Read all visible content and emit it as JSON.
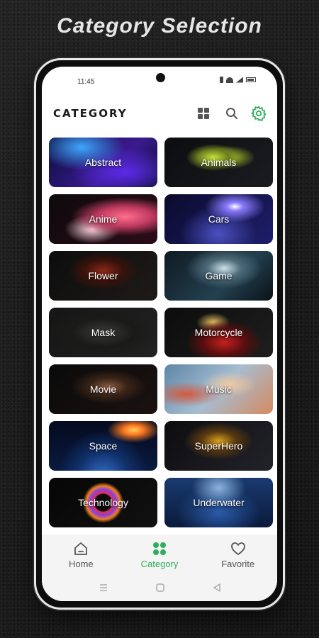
{
  "headline": "Category Selection",
  "status_bar": {
    "time": "11:45"
  },
  "header": {
    "title": "CATEGORY",
    "accent_color": "#2cae5a"
  },
  "categories": [
    {
      "label": "Abstract",
      "style": "abstract"
    },
    {
      "label": "Animals",
      "style": "animals"
    },
    {
      "label": "Anime",
      "style": "anime"
    },
    {
      "label": "Cars",
      "style": "cars"
    },
    {
      "label": "Flower",
      "style": "flower"
    },
    {
      "label": "Game",
      "style": "game"
    },
    {
      "label": "Mask",
      "style": "mask"
    },
    {
      "label": "Motorcycle",
      "style": "motorcycle"
    },
    {
      "label": "Movie",
      "style": "movie"
    },
    {
      "label": "Music",
      "style": "music"
    },
    {
      "label": "Space",
      "style": "space"
    },
    {
      "label": "SuperHero",
      "style": "superhero"
    },
    {
      "label": "Technology",
      "style": "technology"
    },
    {
      "label": "Underwater",
      "style": "underwater"
    }
  ],
  "bottom_nav": {
    "active": "Category",
    "items": [
      {
        "label": "Home",
        "icon": "home-icon"
      },
      {
        "label": "Category",
        "icon": "category-grid-icon"
      },
      {
        "label": "Favorite",
        "icon": "heart-icon"
      }
    ]
  }
}
